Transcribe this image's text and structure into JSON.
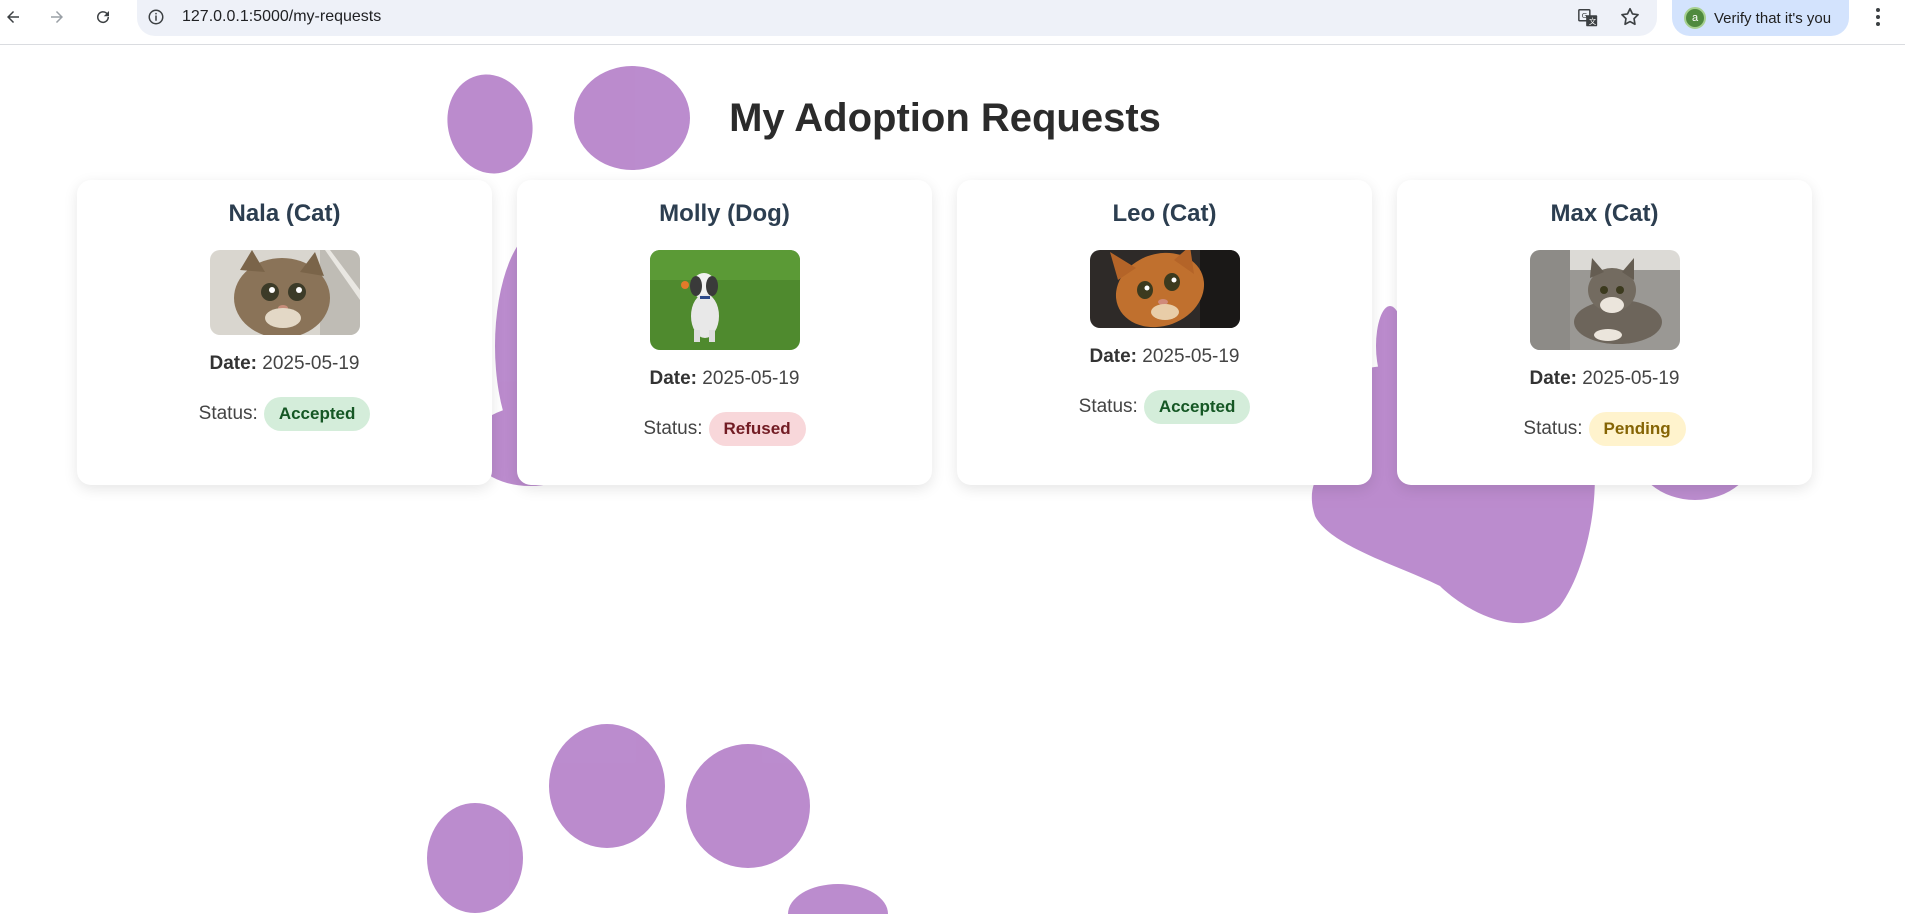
{
  "browser": {
    "url": "127.0.0.1:5000/my-requests",
    "profile_button_label": "Verify that it's you",
    "icons": [
      "back-icon",
      "forward-icon",
      "reload-icon",
      "info-icon",
      "translate-icon",
      "star-icon",
      "menu-icon"
    ]
  },
  "page": {
    "title": "My Adoption Requests",
    "date_label": "Date:",
    "status_label": "Status:"
  },
  "requests": [
    {
      "pet": "Nala (Cat)",
      "date": "2025-05-19",
      "status": "Accepted"
    },
    {
      "pet": "Molly (Dog)",
      "date": "2025-05-19",
      "status": "Refused"
    },
    {
      "pet": "Leo (Cat)",
      "date": "2025-05-19",
      "status": "Accepted"
    },
    {
      "pet": "Max (Cat)",
      "date": "2025-05-19",
      "status": "Pending"
    }
  ],
  "colors": {
    "paw": "#a86bc0",
    "accepted_bg": "#d4edda",
    "refused_bg": "#f8d7da",
    "pending_bg": "#fff3cd",
    "heading": "#2c3e50"
  }
}
